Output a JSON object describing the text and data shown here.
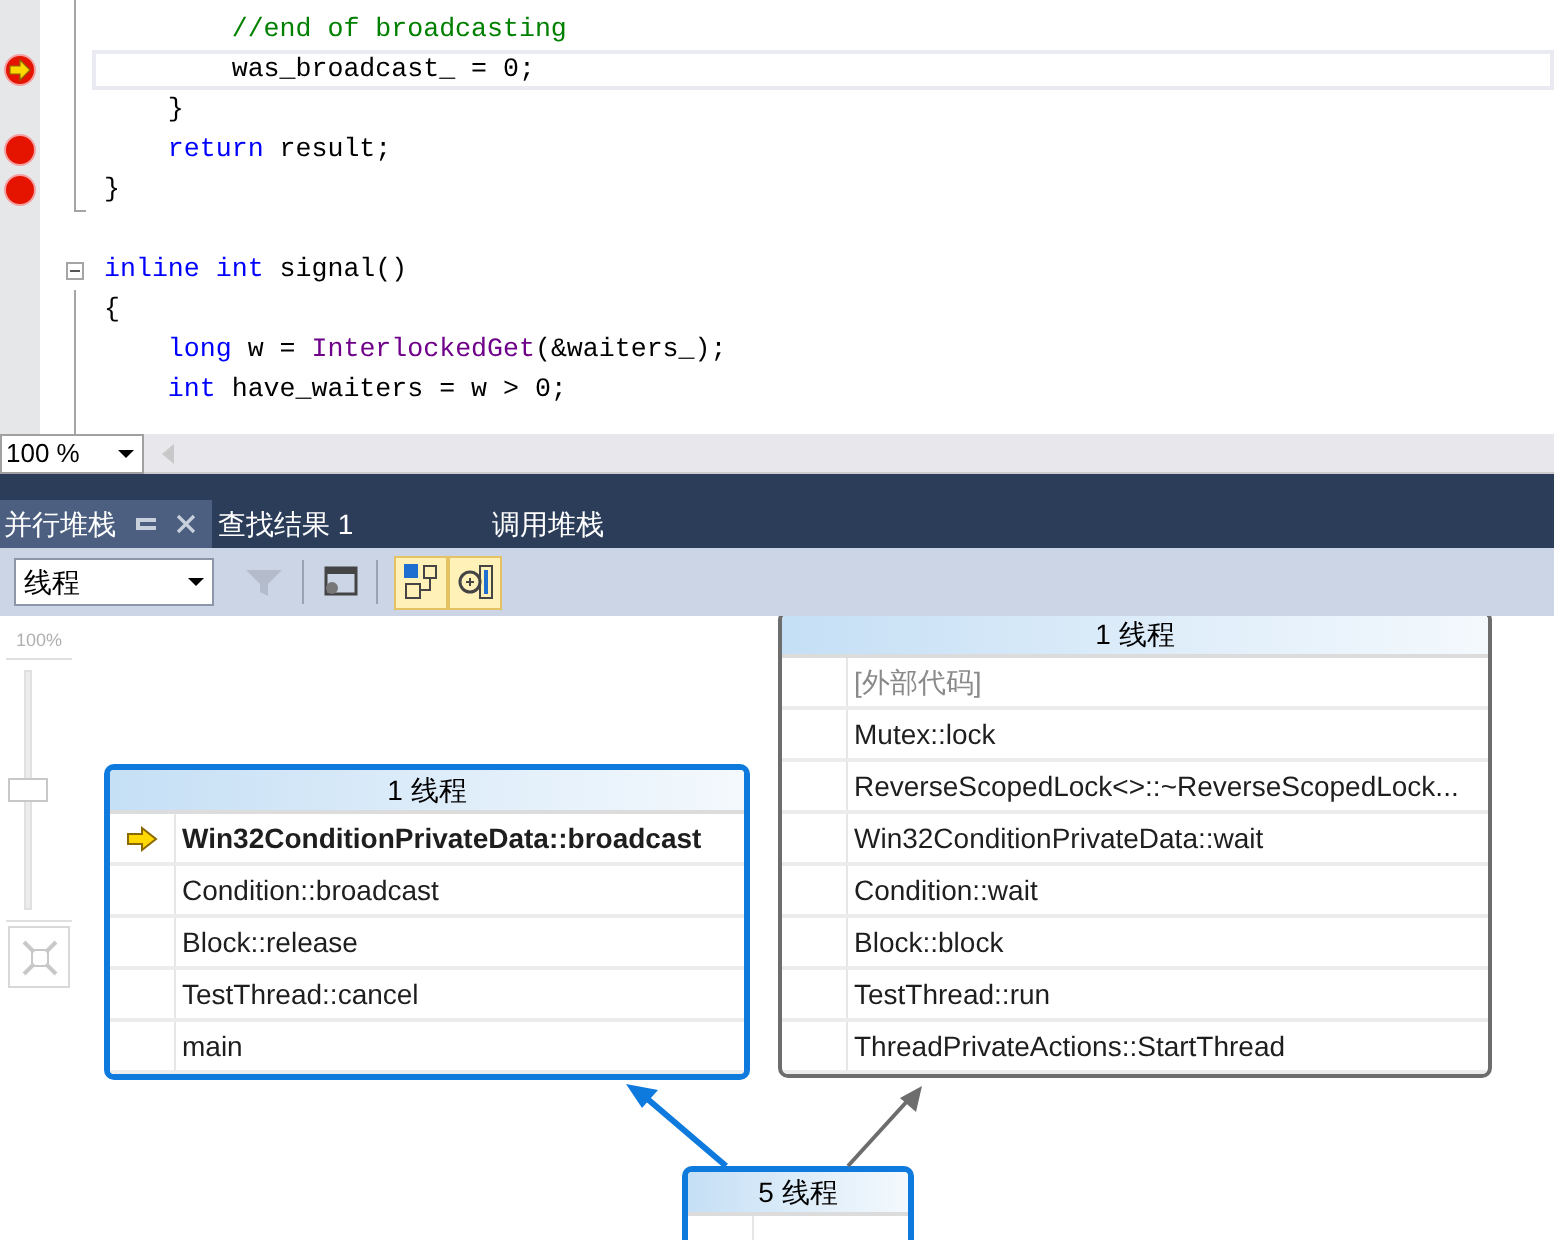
{
  "editor": {
    "lines": [
      {
        "breakpoint": false,
        "current": false,
        "collapsible": false,
        "tokens": [
          {
            "kind": "comment",
            "text": "        //end of broadcasting"
          }
        ]
      },
      {
        "breakpoint": true,
        "current": true,
        "collapsible": false,
        "tokens": [
          {
            "kind": "plain",
            "text": "        was_broadcast_ = 0;"
          }
        ]
      },
      {
        "breakpoint": false,
        "current": false,
        "collapsible": false,
        "tokens": [
          {
            "kind": "plain",
            "text": "    }"
          }
        ]
      },
      {
        "breakpoint": true,
        "current": false,
        "collapsible": false,
        "tokens": [
          {
            "kind": "keyword",
            "text": "    return"
          },
          {
            "kind": "plain",
            "text": " result;"
          }
        ]
      },
      {
        "breakpoint": true,
        "current": false,
        "collapsible": false,
        "tokens": [
          {
            "kind": "plain",
            "text": "}"
          }
        ]
      },
      {
        "breakpoint": false,
        "current": false,
        "collapsible": false
      },
      {
        "breakpoint": false,
        "current": false,
        "collapsible": true,
        "tokens": [
          {
            "kind": "keyword",
            "text": "inline int"
          },
          {
            "kind": "plain",
            "text": " signal()"
          }
        ]
      },
      {
        "breakpoint": false,
        "current": false,
        "collapsible": false,
        "tokens": [
          {
            "kind": "plain",
            "text": "{"
          }
        ]
      },
      {
        "breakpoint": false,
        "current": false,
        "collapsible": false,
        "tokens": [
          {
            "kind": "keyword",
            "text": "    long"
          },
          {
            "kind": "plain",
            "text": " w = "
          },
          {
            "kind": "function",
            "text": "InterlockedGet"
          },
          {
            "kind": "plain",
            "text": "(&waiters_);"
          }
        ]
      },
      {
        "breakpoint": false,
        "current": false,
        "collapsible": false,
        "tokens": [
          {
            "kind": "keyword",
            "text": "    int"
          },
          {
            "kind": "plain",
            "text": " have_waiters = w > 0;"
          }
        ]
      }
    ],
    "zoom": "100 %"
  },
  "tabs": [
    {
      "label": "并行堆栈",
      "selected": true
    },
    {
      "label": "查找结果 1",
      "selected": false
    },
    {
      "label": "调用堆栈",
      "selected": false
    }
  ],
  "toolbar": {
    "view": "线程",
    "filter_enabled": false,
    "toggles": [
      {
        "on": true
      },
      {
        "on": true
      }
    ]
  },
  "zoom_slider": {
    "label": "100%",
    "level": 0.5
  },
  "nodes": [
    {
      "title": "1 线程",
      "highlighted": true,
      "frames": [
        {
          "text": "Win32ConditionPrivateData::broadcast",
          "current": true,
          "external": false
        },
        {
          "text": "Condition::broadcast",
          "current": false,
          "external": false
        },
        {
          "text": "Block::release",
          "current": false,
          "external": false
        },
        {
          "text": "TestThread::cancel",
          "current": false,
          "external": false
        },
        {
          "text": "main",
          "current": false,
          "external": false
        }
      ]
    },
    {
      "title": "1 线程",
      "highlighted": false,
      "frames": [
        {
          "text": "[外部代码]",
          "current": false,
          "external": true
        },
        {
          "text": "Mutex::lock",
          "current": false,
          "external": false
        },
        {
          "text": "ReverseScopedLock<>::~ReverseScopedLock...",
          "current": false,
          "external": false
        },
        {
          "text": "Win32ConditionPrivateData::wait",
          "current": false,
          "external": false
        },
        {
          "text": "Condition::wait",
          "current": false,
          "external": false
        },
        {
          "text": "Block::block",
          "current": false,
          "external": false
        },
        {
          "text": "TestThread::run",
          "current": false,
          "external": false
        },
        {
          "text": "ThreadPrivateActions::StartThread",
          "current": false,
          "external": false
        }
      ]
    },
    {
      "title": "5 线程",
      "highlighted": true
    }
  ]
}
